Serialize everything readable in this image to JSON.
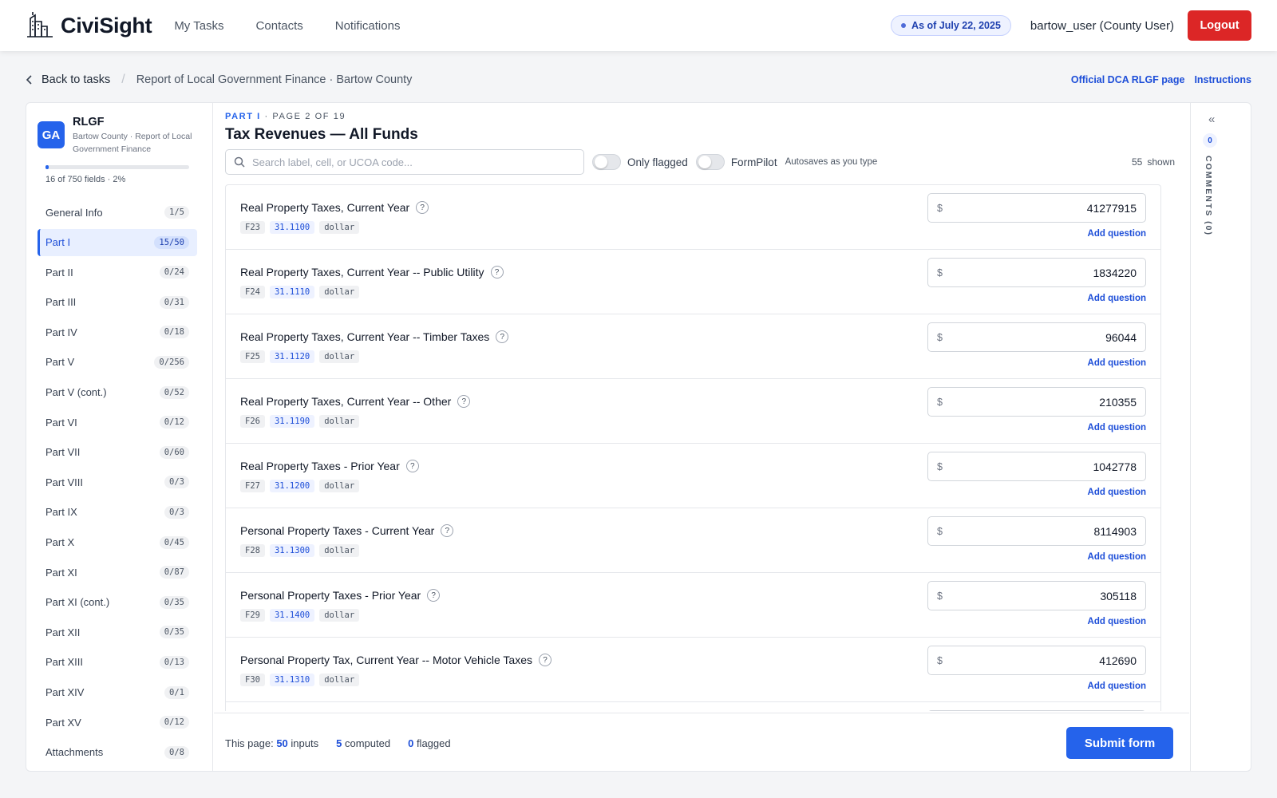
{
  "app": {
    "brand": "CiviSight",
    "nav": [
      "My Tasks",
      "Contacts",
      "Notifications"
    ],
    "as_of": "As of July 22, 2025",
    "user": "bartow_user (County User)",
    "logout": "Logout"
  },
  "breadcrumb": {
    "back": "Back to tasks",
    "title": "Report of Local Government Finance · Bartow County",
    "links": [
      "Official DCA RLGF page",
      "Instructions"
    ]
  },
  "sidebar": {
    "badge": "GA",
    "title": "RLGF",
    "subtitle": "Bartow County · Report of Local Government Finance",
    "progress_fraction": 0.02,
    "fields_count": "16 of 750 fields · 2%",
    "parts": [
      {
        "label": "General Info",
        "count": "1/5"
      },
      {
        "label": "Part I",
        "count": "15/50",
        "active": true
      },
      {
        "label": "Part II",
        "count": "0/24"
      },
      {
        "label": "Part III",
        "count": "0/31"
      },
      {
        "label": "Part IV",
        "count": "0/18"
      },
      {
        "label": "Part V",
        "count": "0/256"
      },
      {
        "label": "Part V (cont.)",
        "count": "0/52"
      },
      {
        "label": "Part VI",
        "count": "0/12"
      },
      {
        "label": "Part VII",
        "count": "0/60"
      },
      {
        "label": "Part VIII",
        "count": "0/3"
      },
      {
        "label": "Part IX",
        "count": "0/3"
      },
      {
        "label": "Part X",
        "count": "0/45"
      },
      {
        "label": "Part XI",
        "count": "0/87"
      },
      {
        "label": "Part XI (cont.)",
        "count": "0/35"
      },
      {
        "label": "Part XII",
        "count": "0/35"
      },
      {
        "label": "Part XIII",
        "count": "0/13"
      },
      {
        "label": "Part XIV",
        "count": "0/1"
      },
      {
        "label": "Part XV",
        "count": "0/12"
      },
      {
        "label": "Attachments",
        "count": "0/8"
      }
    ]
  },
  "page": {
    "part": "PART I",
    "page_info": "· PAGE 2 OF 19",
    "title": "Tax Revenues — All Funds",
    "search_placeholder": "Search label, cell, or UCOA code...",
    "only_flagged": "Only flagged",
    "formpilot": "FormPilot",
    "autosave": "Autosaves as you type",
    "shown_count": "55",
    "shown_label": "shown"
  },
  "fields": [
    {
      "label": "Real Property Taxes, Current Year",
      "cell": "F23",
      "code": "31.1100",
      "unit": "dollar",
      "value": "41277915"
    },
    {
      "label": "Real Property Taxes, Current Year -- Public Utility",
      "cell": "F24",
      "code": "31.1110",
      "unit": "dollar",
      "value": "1834220"
    },
    {
      "label": "Real Property Taxes, Current Year -- Timber Taxes",
      "cell": "F25",
      "code": "31.1120",
      "unit": "dollar",
      "value": "96044"
    },
    {
      "label": "Real Property Taxes, Current Year -- Other",
      "cell": "F26",
      "code": "31.1190",
      "unit": "dollar",
      "value": "210355"
    },
    {
      "label": "Real Property Taxes - Prior Year",
      "cell": "F27",
      "code": "31.1200",
      "unit": "dollar",
      "value": "1042778"
    },
    {
      "label": "Personal Property Taxes - Current Year",
      "cell": "F28",
      "code": "31.1300",
      "unit": "dollar",
      "value": "8114903"
    },
    {
      "label": "Personal Property Taxes - Prior Year",
      "cell": "F29",
      "code": "31.1400",
      "unit": "dollar",
      "value": "305118"
    },
    {
      "label": "Personal Property Tax, Current Year -- Motor Vehicle Taxes",
      "cell": "F30",
      "code": "31.1310",
      "unit": "dollar",
      "value": "412690"
    }
  ],
  "field_ui": {
    "currency": "$",
    "help": "?",
    "add_question": "Add question"
  },
  "footer": {
    "this_page_prefix": "This page:",
    "inputs_count": "50",
    "inputs_label": "inputs",
    "computed_count": "5",
    "computed_label": "computed",
    "flagged_count": "0",
    "flagged_label": "flagged",
    "submit": "Submit form"
  },
  "comments": {
    "collapse": "«",
    "count": "0",
    "label": "COMMENTS (0)"
  },
  "colors": {
    "accent": "#2563eb",
    "danger": "#dc2626",
    "link": "#1d4ed8"
  }
}
